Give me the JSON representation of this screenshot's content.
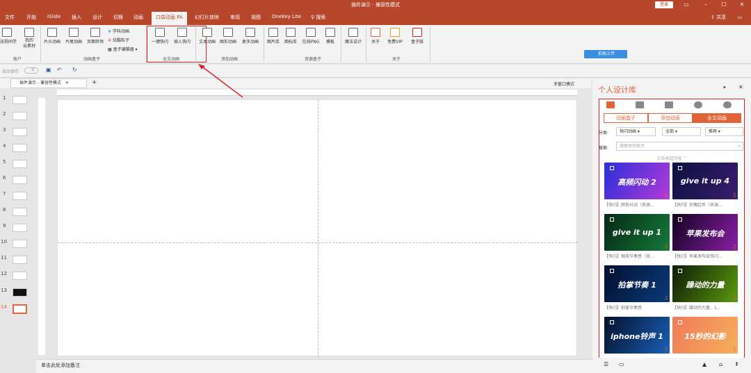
{
  "window": {
    "title": "插件演示 - 兼容性模式",
    "login": "登录",
    "share": "共享"
  },
  "tabs": [
    "文件",
    "开始",
    "iSlide",
    "插入",
    "设计",
    "切换",
    "动画",
    "口袋动画 PA",
    "幻灯片放映",
    "审阅",
    "视图",
    "OneKey Lite",
    "搜索"
  ],
  "ribbon": {
    "account_btns": [
      "张扬同学",
      "我的\n云素材"
    ],
    "account_group": "账户",
    "anim_box_btns": [
      "片头动画",
      "片尾动画",
      "页面转场"
    ],
    "anim_box_small": [
      "学科动画",
      "炫酷粒子",
      "盒子编辑器"
    ],
    "anim_box_group": "动画盒子",
    "full_btns": [
      "一键快闪",
      "插入快闪"
    ],
    "full_group": "全文动画",
    "add_btns": [
      "文本动画",
      "图形动画",
      "更多动画"
    ],
    "add_group": "添加动画",
    "res_btns": [
      "图片库",
      "图标库",
      "在线PNG",
      "模板"
    ],
    "res_group": "资源盒子",
    "magic": "魔法设计",
    "about_btns": [
      "关于",
      "免费VIP",
      "盒子版"
    ],
    "about_group": "关于",
    "upload": "拍拖上传"
  },
  "qat": {
    "autosave": "自动保存",
    "off": "关",
    "multiwin": "多窗口模式"
  },
  "doc_tab": "插件演示 - 兼容性模式",
  "slides": [
    "1",
    "2",
    "3",
    "4",
    "5",
    "6",
    "7",
    "8",
    "9",
    "10",
    "11",
    "12",
    "13",
    "14"
  ],
  "notes_placeholder": "单击此处添加备注",
  "pane": {
    "title": "个人设计库",
    "tabs": [
      "动画盒子",
      "添加动画",
      "全文动画"
    ],
    "category_label": "分类:",
    "category": "快闪动画",
    "all": "全部",
    "sort": "推荐",
    "search_label": "搜索:",
    "search_placeholder": "搜索体验更多",
    "collapse": "点击收起内容 ^",
    "cards": [
      {
        "title": "高频闪动 2",
        "caption": "【快闪】颜色抖动（来源..."
      },
      {
        "title": "give it up 4",
        "caption": "【快闪】狂舞起伴（来源..."
      },
      {
        "title": "give it up 1",
        "caption": "【快闪】缩放节奏感（来..."
      },
      {
        "title": "苹果发布会",
        "caption": "【快闪】苹果发布会快闪..."
      },
      {
        "title": "拍掌节奏 1",
        "caption": "【快闪】拍掌节奏感"
      },
      {
        "title": "躁动的力量",
        "caption": "【快闪】躁动的力量、1..."
      },
      {
        "title": "iphone铃声 1",
        "caption": ""
      },
      {
        "title": "15秒的幻影",
        "caption": ""
      }
    ]
  },
  "colors": {
    "brand": "#b7472a",
    "accent": "#e06437",
    "highlight": "#e02020"
  }
}
